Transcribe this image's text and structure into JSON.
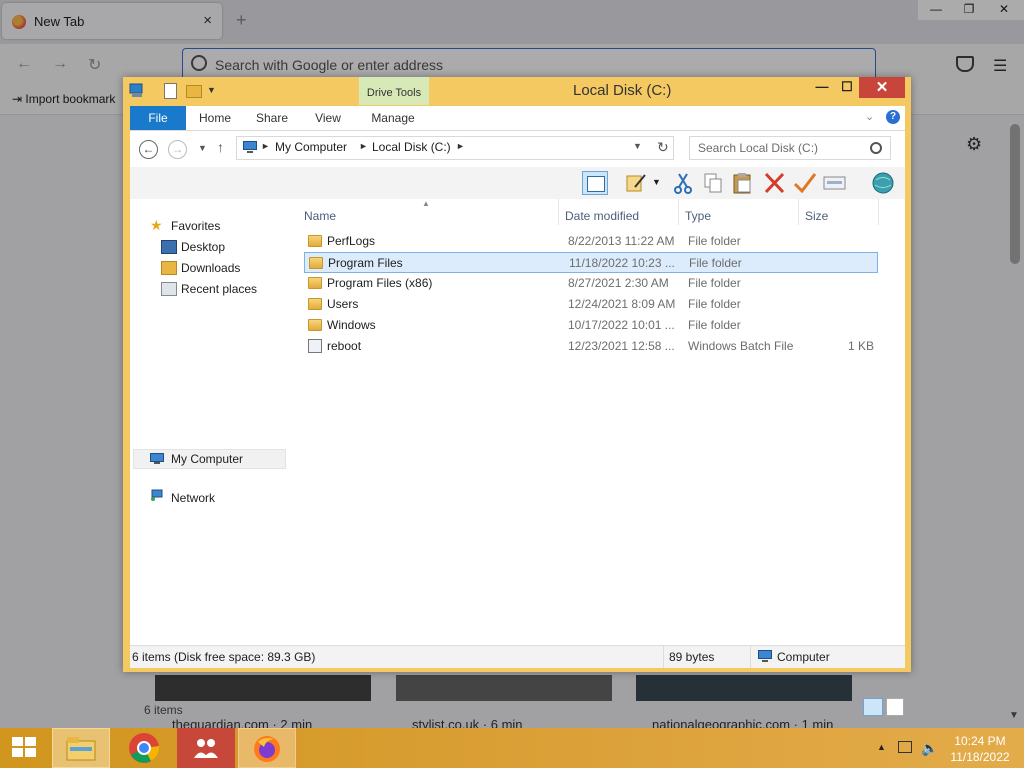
{
  "browser": {
    "tab_title": "New Tab",
    "tab_close": "×",
    "new_tab": "+",
    "url_placeholder": "Search with Google or enter address",
    "import_bookmarks": "Import bookmark",
    "tiles": [
      {
        "label": "theguardian.com · 2 min"
      },
      {
        "label": "stylist.co.uk · 6 min"
      },
      {
        "label": "nationalgeographic.com · 1 min"
      }
    ],
    "icons": [
      "back-icon",
      "forward-icon",
      "reload-icon",
      "pocket-icon",
      "menu-icon",
      "gear-icon"
    ]
  },
  "explorer": {
    "title": "Local Disk (C:)",
    "context_tab": "Drive Tools",
    "ribbon_tabs": [
      "File",
      "Home",
      "Share",
      "View",
      "Manage"
    ],
    "breadcrumb": [
      "My Computer",
      "Local Disk (C:)"
    ],
    "search_placeholder": "Search Local Disk (C:)",
    "nav_pane": {
      "favorites": "Favorites",
      "favorites_items": [
        "Desktop",
        "Downloads",
        "Recent places"
      ],
      "my_computer": "My Computer",
      "network": "Network"
    },
    "columns": [
      "Name",
      "Date modified",
      "Type",
      "Size"
    ],
    "files": [
      {
        "name": "PerfLogs",
        "date": "8/22/2013 11:22 AM",
        "type": "File folder",
        "size": "",
        "icon": "folder-icon",
        "selected": false
      },
      {
        "name": "Program Files",
        "date": "11/18/2022 10:23 ...",
        "type": "File folder",
        "size": "",
        "icon": "folder-icon",
        "selected": true
      },
      {
        "name": "Program Files (x86)",
        "date": "8/27/2021 2:30 AM",
        "type": "File folder",
        "size": "",
        "icon": "folder-icon",
        "selected": false
      },
      {
        "name": "Users",
        "date": "12/24/2021 8:09 AM",
        "type": "File folder",
        "size": "",
        "icon": "folder-icon",
        "selected": false
      },
      {
        "name": "Windows",
        "date": "10/17/2022 10:01 ...",
        "type": "File folder",
        "size": "",
        "icon": "folder-icon",
        "selected": false
      },
      {
        "name": "reboot",
        "date": "12/23/2021 12:58 ...",
        "type": "Windows Batch File",
        "size": "1 KB",
        "icon": "batch-file-icon",
        "selected": false
      }
    ],
    "item_count": "6 items",
    "status_left": "6 items (Disk free space: 89.3 GB)",
    "status_size": "89 bytes",
    "status_location": "Computer"
  },
  "taskbar": {
    "time": "10:24 PM",
    "date": "11/18/2022",
    "apps": [
      "file-explorer-icon",
      "chrome-icon",
      "people-icon",
      "firefox-icon"
    ]
  },
  "colors": {
    "window_frame": "#f4c962",
    "file_tab": "#1979ca",
    "selection": "#dcecfc",
    "close_button": "#c7453b",
    "taskbar": "#d8a030"
  }
}
